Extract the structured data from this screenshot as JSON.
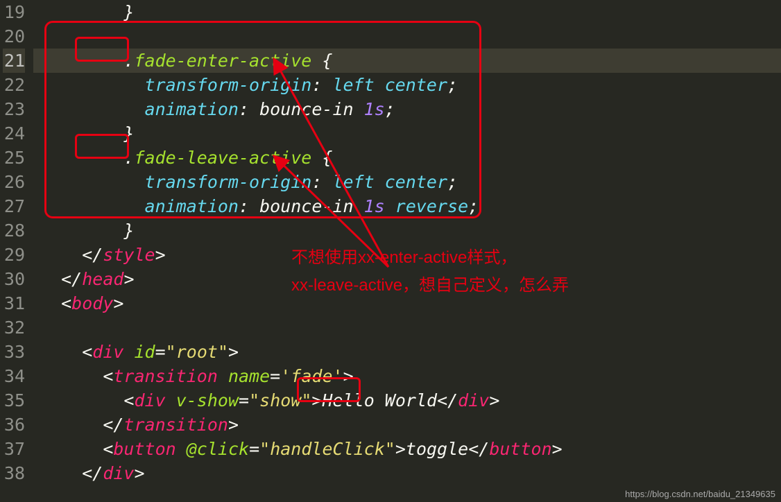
{
  "lines": {
    "start": 19,
    "end": 38,
    "activeLine": 21
  },
  "code": {
    "l19": {
      "indent": "        ",
      "brace": "}"
    },
    "l20": {
      "indent": ""
    },
    "l21": {
      "indent": "        ",
      "dot": ".",
      "sel": "fade-enter-active",
      "sp": " ",
      "brace": "{"
    },
    "l22": {
      "indent": "          ",
      "prop": "transform-origin",
      "colon": ": ",
      "val": "left center",
      "semi": ";"
    },
    "l23": {
      "indent": "          ",
      "prop": "animation",
      "colon": ": ",
      "val1": "bounce-in ",
      "val2": "1s",
      "semi": ";"
    },
    "l24": {
      "indent": "        ",
      "brace": "}"
    },
    "l25": {
      "indent": "        ",
      "dot": ".",
      "sel": "fade-leave-active",
      "sp": " ",
      "brace": "{"
    },
    "l26": {
      "indent": "          ",
      "prop": "transform-origin",
      "colon": ": ",
      "val": "left center",
      "semi": ";"
    },
    "l27": {
      "indent": "          ",
      "prop": "animation",
      "colon": ": ",
      "val1": "bounce-in ",
      "val2": "1s",
      "val3": " reverse",
      "semi": ";"
    },
    "l28": {
      "indent": "        ",
      "brace": "}"
    },
    "l29": {
      "indent": "    ",
      "open": "</",
      "tag": "style",
      "close": ">"
    },
    "l30": {
      "indent": "  ",
      "open": "</",
      "tag": "head",
      "close": ">"
    },
    "l31": {
      "indent": "  ",
      "open": "<",
      "tag": "body",
      "close": ">"
    },
    "l32": {
      "indent": ""
    },
    "l33": {
      "indent": "    ",
      "open": "<",
      "tag": "div",
      "sp": " ",
      "attr": "id",
      "eq": "=",
      "q1": "\"",
      "val": "root",
      "q2": "\"",
      "close": ">"
    },
    "l34": {
      "indent": "      ",
      "open": "<",
      "tag": "transition",
      "sp": " ",
      "attr": "name",
      "eq": "=",
      "q1": "'",
      "val": "fade",
      "q2": "'",
      "close": ">"
    },
    "l35": {
      "indent": "        ",
      "open": "<",
      "tag": "div",
      "sp": " ",
      "attr": "v-show",
      "eq": "=",
      "q1": "\"",
      "val": "show",
      "q2": "\"",
      "close": ">",
      "text": "Hello World",
      "open2": "</",
      "tag2": "div",
      "close2": ">"
    },
    "l36": {
      "indent": "      ",
      "open": "</",
      "tag": "transition",
      "close": ">"
    },
    "l37": {
      "indent": "      ",
      "open": "<",
      "tag": "button",
      "sp": " ",
      "attr": "@click",
      "eq": "=",
      "q1": "\"",
      "val": "handleClick",
      "q2": "\"",
      "close": ">",
      "text": "toggle",
      "open2": "</",
      "tag2": "button",
      "close2": ">"
    },
    "l38": {
      "indent": "    ",
      "open": "</",
      "tag": "div",
      "close": ">"
    }
  },
  "annotation": {
    "line1": "不想使用xx-enter-active样式，",
    "line2": "xx-leave-active，想自己定义，怎么弄"
  },
  "watermark": "https://blog.csdn.net/baidu_21349635"
}
